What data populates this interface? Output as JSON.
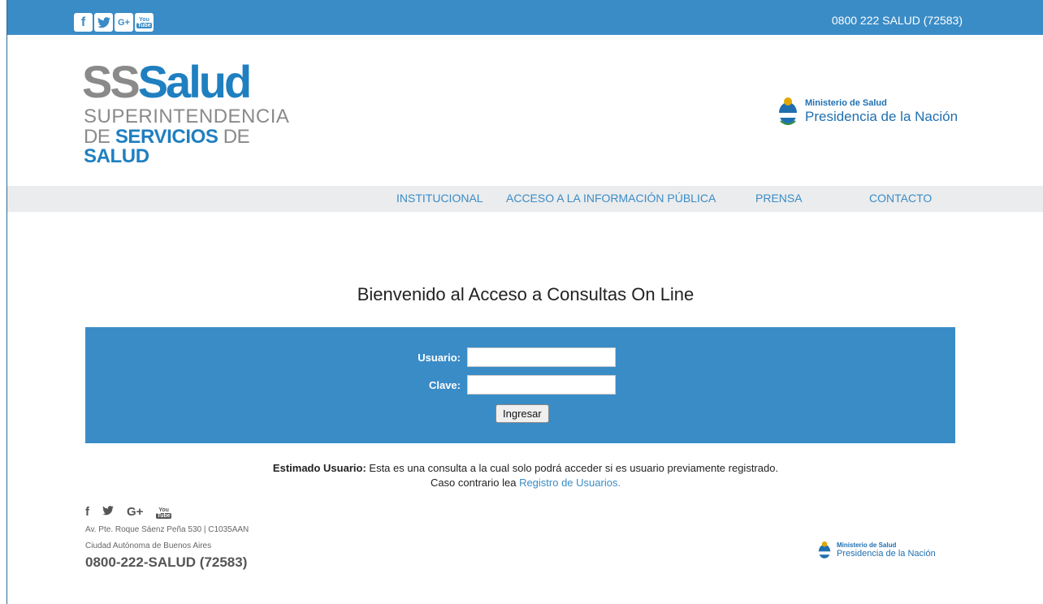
{
  "topbar": {
    "social": [
      {
        "icon": "facebook-icon",
        "glyph": "f"
      },
      {
        "icon": "twitter-icon",
        "glyph": "🐦"
      },
      {
        "icon": "google-plus-icon",
        "glyph": "G+"
      },
      {
        "icon": "youtube-icon",
        "top": "You",
        "bottom": "Tube"
      }
    ],
    "phone": "0800 222 SALUD (72583)"
  },
  "logo": {
    "ss": "SS",
    "salud": "Salud",
    "line2": "SUPERINTENDENCIA",
    "line3_de": "DE ",
    "line3_servicios": "SERVICIOS",
    "line3_de2": " DE ",
    "line3_salud": "SALUD"
  },
  "ministry": {
    "line1": "Ministerio de Salud",
    "line2": "Presidencia de la Nación"
  },
  "nav": {
    "items": [
      "INSTITUCIONAL",
      "ACCESO A LA INFORMACIÓN PÚBLICA",
      "PRENSA",
      "CONTACTO"
    ]
  },
  "main": {
    "welcome": "Bienvenido al Acceso a Consultas On Line",
    "user_label": "Usuario:",
    "user_value": "",
    "pass_label": "Clave:",
    "pass_value": "",
    "submit": "Ingresar",
    "notice_bold": "Estimado Usuario:",
    "notice_text": " Esta es una consulta a la cual solo podrá acceder si es usuario previamente registrado.",
    "notice_line2": "Caso contrario lea ",
    "notice_link": "Registro de Usuarios."
  },
  "footer": {
    "icons": [
      "facebook-icon",
      "twitter-icon",
      "google-plus-icon",
      "youtube-icon"
    ],
    "address1": "Av. Pte. Roque Sáenz Peña 530 | C1035AAN",
    "address2": "Ciudad Autónoma de Buenos Aires",
    "phone": "0800-222-SALUD (72583)",
    "ministry1": "Ministerio de Salud",
    "ministry2": "Presidencia de la Nación"
  },
  "colors": {
    "primary": "#3a8cc7",
    "brand_blue": "#1f7fc0",
    "nav_bg": "#ebeced"
  }
}
